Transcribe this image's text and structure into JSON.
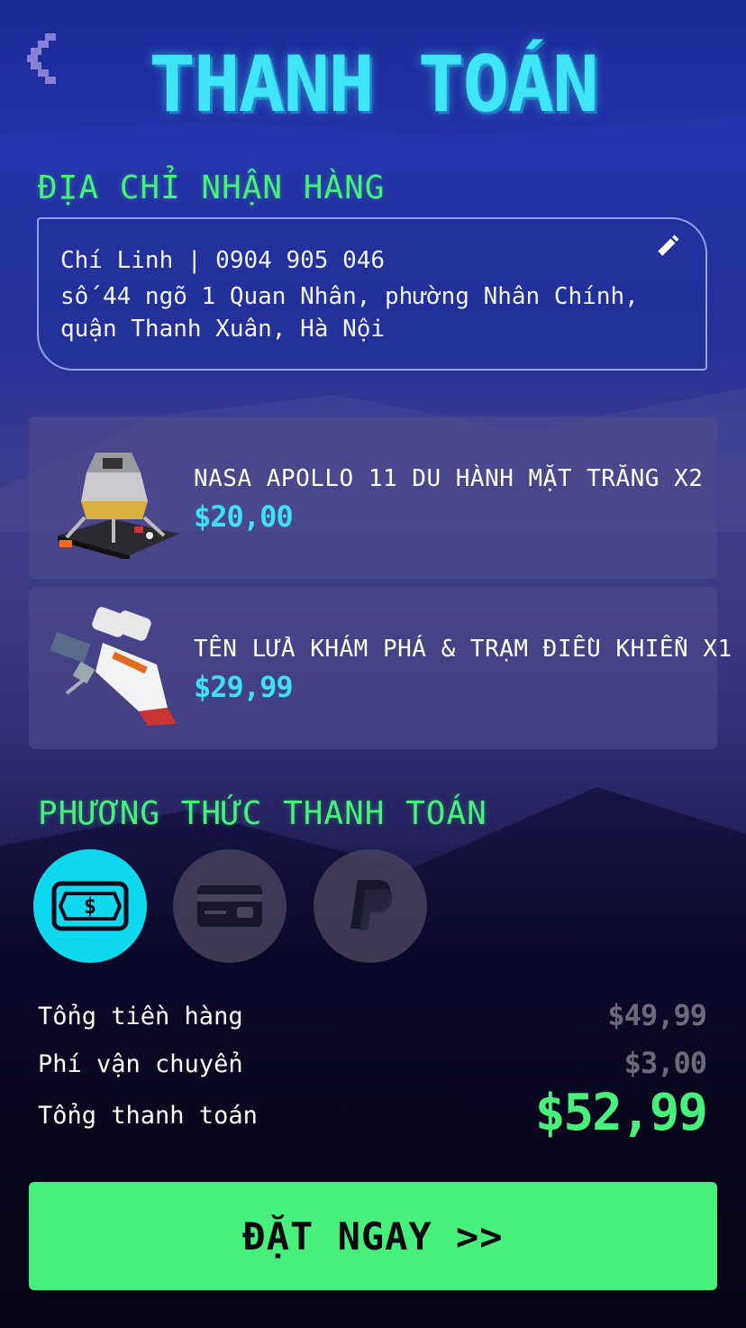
{
  "header": {
    "title": "THANH TOÁN"
  },
  "address_section": {
    "title": "ĐỊA CHỈ NHẬN HÀNG",
    "name_phone": "Chí Linh | 0904 905 046",
    "address": "số 44 ngõ 1 Quan Nhân, phường Nhân Chính, quận Thanh Xuân, Hà Nội"
  },
  "products": [
    {
      "name": "NASA APOLLO 11 DU HÀNH MẶT TRĂNG X2",
      "price": "$20,00"
    },
    {
      "name": "TÊN LỬA KHÁM PHÁ & TRẠM ĐIỀU KHIỂN X1",
      "price": "$29,99"
    }
  ],
  "payment_section": {
    "title": "PHƯƠNG THỨC THANH TOÁN",
    "methods": [
      {
        "icon": "cash-icon",
        "selected": true
      },
      {
        "icon": "credit-card-icon",
        "selected": false
      },
      {
        "icon": "paypal-icon",
        "selected": false
      }
    ]
  },
  "summary": {
    "subtotal_label": "Tổng tiền hàng",
    "subtotal_value": "$49,99",
    "shipping_label": "Phí vận chuyển",
    "shipping_value": "$3,00",
    "total_label": "Tổng thanh toán",
    "total_value": "$52,99"
  },
  "order_button": {
    "label": "ĐẶT NGAY >>"
  },
  "colors": {
    "accent_cyan": "#3fe6f8",
    "accent_green": "#46f07a",
    "muted_price": "#6b6b78"
  }
}
